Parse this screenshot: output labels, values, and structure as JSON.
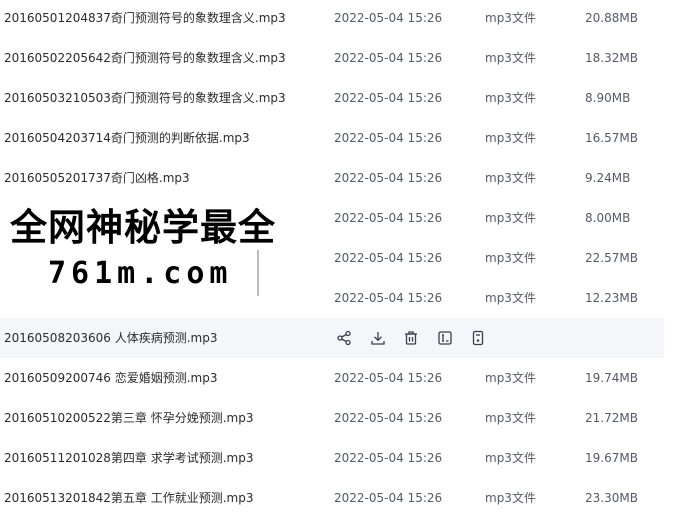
{
  "files": [
    {
      "name": "20160501204837奇门预测符号的象数理含义.mp3",
      "date": "2022-05-04 15:26",
      "type": "mp3文件",
      "size": "20.88MB"
    },
    {
      "name": "20160502205642奇门预测符号的象数理含义.mp3",
      "date": "2022-05-04 15:26",
      "type": "mp3文件",
      "size": "18.32MB"
    },
    {
      "name": "20160503210503奇门预测符号的象数理含义.mp3",
      "date": "2022-05-04 15:26",
      "type": "mp3文件",
      "size": "8.90MB"
    },
    {
      "name": "20160504203714奇门预测的判断依据.mp3",
      "date": "2022-05-04 15:26",
      "type": "mp3文件",
      "size": "16.57MB"
    },
    {
      "name": "20160505201737奇门凶格.mp3",
      "date": "2022-05-04 15:26",
      "type": "mp3文件",
      "size": "9.24MB"
    },
    {
      "name": "",
      "date": "2022-05-04 15:26",
      "type": "mp3文件",
      "size": "8.00MB"
    },
    {
      "name": "",
      "date": "2022-05-04 15:26",
      "type": "mp3文件",
      "size": "22.57MB"
    },
    {
      "name": "",
      "date": "2022-05-04 15:26",
      "type": "mp3文件",
      "size": "12.23MB"
    },
    {
      "name": "20160508203606 人体疾病预测.mp3",
      "hover": true
    },
    {
      "name": "20160509200746 恋爱婚姻预测.mp3",
      "date": "2022-05-04 15:26",
      "type": "mp3文件",
      "size": "19.74MB"
    },
    {
      "name": "20160510200522第三章 怀孕分娩预测.mp3",
      "date": "2022-05-04 15:26",
      "type": "mp3文件",
      "size": "21.72MB"
    },
    {
      "name": "20160511201028第四章 求学考试预测.mp3",
      "date": "2022-05-04 15:26",
      "type": "mp3文件",
      "size": "19.67MB"
    },
    {
      "name": "20160513201842第五章 工作就业预测.mp3",
      "date": "2022-05-04 15:26",
      "type": "mp3文件",
      "size": "23.30MB"
    }
  ],
  "hover_actions": [
    "share-icon",
    "download-icon",
    "delete-icon",
    "rename-icon",
    "more-icon"
  ],
  "watermark": {
    "title": "全网神秘学最全",
    "subtitle": "761m.com"
  },
  "colors": {
    "text": "#2b2b2b",
    "meta": "#555a66",
    "hover_bg": "#f5f6fa",
    "icon": "#3a3f4b"
  }
}
